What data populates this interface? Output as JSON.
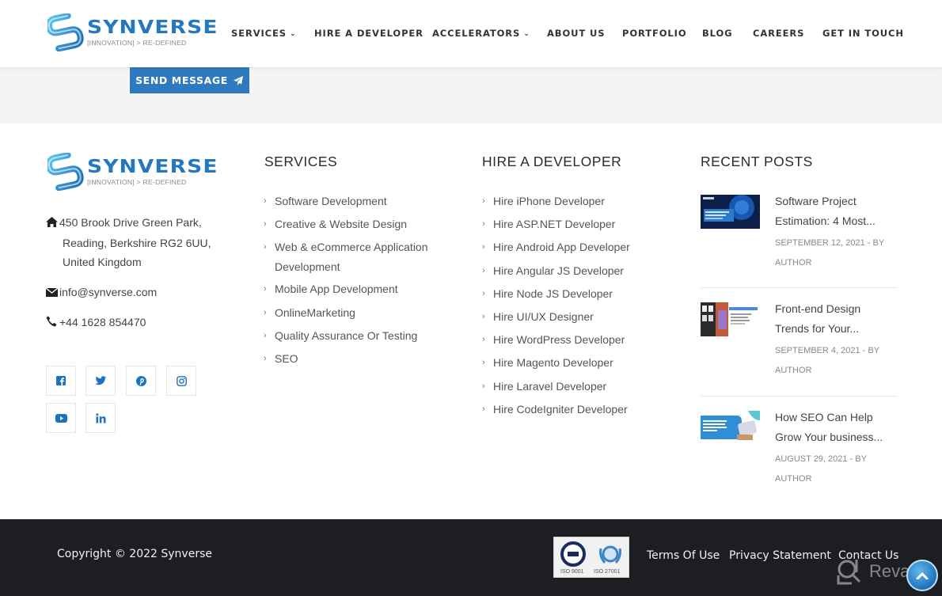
{
  "brand": {
    "name": "SYNVERSE",
    "tagline": "[INNOVATION] > RE-DEFINED",
    "color": "#2478c0"
  },
  "nav": {
    "items": [
      {
        "label": "SERVICES",
        "has_dropdown": true
      },
      {
        "label": "HIRE A DEVELOPER",
        "has_dropdown": false
      },
      {
        "label": "ACCELERATORS",
        "has_dropdown": true
      },
      {
        "label": "ABOUT US",
        "has_dropdown": false
      },
      {
        "label": "PORTFOLIO",
        "has_dropdown": false
      },
      {
        "label": "BLOG",
        "has_dropdown": false
      },
      {
        "label": "CAREERS",
        "has_dropdown": false
      },
      {
        "label": "GET IN TOUCH",
        "has_dropdown": false
      }
    ]
  },
  "contact_form": {
    "send_label": "SEND MESSAGE",
    "button_color": "#2f7abf"
  },
  "footer": {
    "company": {
      "address_line1": "450 Brook Drive Green Park,",
      "address_line2": "Reading, Berkshire RG2 6UU,",
      "address_line3": "United Kingdom",
      "email": "info@synverse.com",
      "phone": "+44 1628 854470"
    },
    "social": [
      {
        "icon": "facebook-icon"
      },
      {
        "icon": "twitter-icon"
      },
      {
        "icon": "pinterest-icon"
      },
      {
        "icon": "instagram-icon"
      },
      {
        "icon": "youtube-icon"
      },
      {
        "icon": "linkedin-icon"
      }
    ],
    "services": {
      "title": "SERVICES",
      "items": [
        "Software Development",
        "Creative & Website Design",
        "Web & eCommerce Application Development",
        "Mobile App Development",
        "OnlineMarketing",
        "Quality Assurance Or Testing",
        "SEO"
      ]
    },
    "hire": {
      "title": "HIRE A DEVELOPER",
      "items": [
        "Hire iPhone Developer",
        "Hire ASP.NET Developer",
        "Hire Android App Developer",
        "Hire Angular JS Developer",
        "Hire Node JS Developer",
        "Hire UI/UX Designer",
        "Hire WordPress Developer",
        "Hire Magento Developer",
        "Hire Laravel Developer",
        "Hire CodeIgniter Developer"
      ]
    },
    "recent_posts": {
      "title": "RECENT POSTS",
      "posts": [
        {
          "title_line1": "Software Project",
          "title_line2": "Estimation: 4 Most...",
          "meta_line1": "SEPTEMBER 12, 2021 - BY",
          "meta_line2": "AUTHOR"
        },
        {
          "title_line1": "Front-end Design",
          "title_line2": "Trends for Your...",
          "meta_line1": "SEPTEMBER 4, 2021 - BY",
          "meta_line2": "AUTHOR"
        },
        {
          "title_line1": "How SEO Can Help",
          "title_line2": "Grow Your business...",
          "meta_line1": "AUGUST 29, 2021 - BY",
          "meta_line2": "AUTHOR"
        }
      ]
    }
  },
  "bottom_bar": {
    "copyright": "Copyright © 2022 Synverse",
    "iso": [
      "ISO 9001",
      "ISO 27001"
    ],
    "links": [
      "Terms Of Use",
      "Privacy Statement",
      "Contact Us"
    ],
    "watermark": "Revain"
  }
}
